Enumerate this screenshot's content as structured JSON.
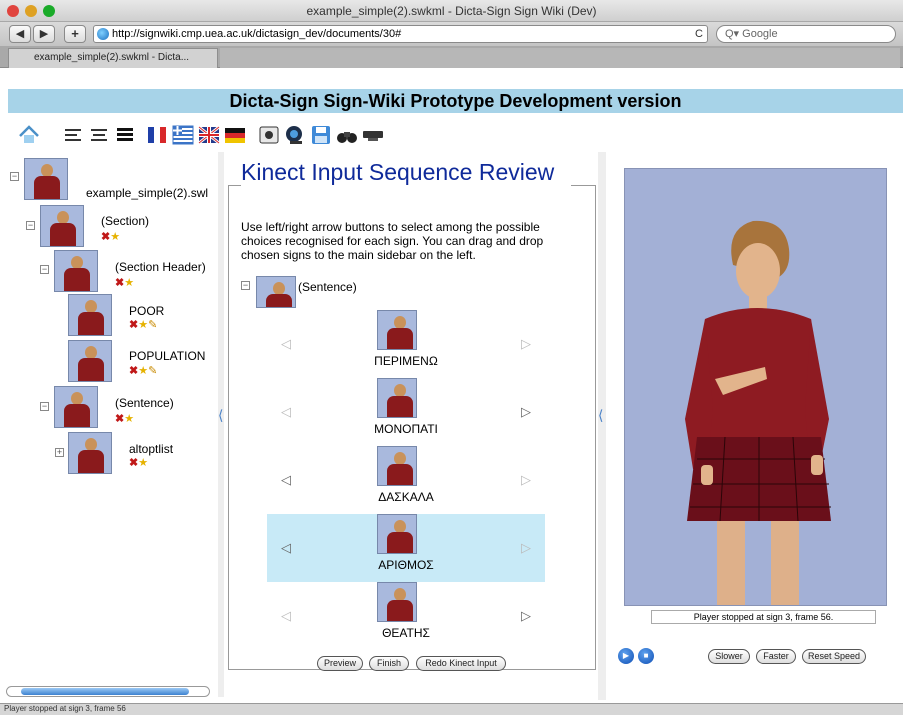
{
  "window": {
    "title": "example_simple(2).swkml - Dicta-Sign Sign Wiki (Dev)"
  },
  "nav": {
    "url": "http://signwiki.cmp.uea.ac.uk/dictasign_dev/documents/30#",
    "search_placeholder": "Google",
    "reload": "C"
  },
  "tab": {
    "label": "example_simple(2).swkml - Dicta..."
  },
  "banner": {
    "title": "Dicta-Sign Sign-Wiki Prototype Development version"
  },
  "toolbar": {
    "icons": [
      "home-icon",
      "align-left-icon",
      "align-center-icon",
      "align-justify-icon",
      "flag-fr-icon",
      "flag-gr-icon",
      "flag-uk-icon",
      "flag-de-icon",
      "kinect-icon",
      "webcam-icon",
      "save-icon",
      "binoculars-icon",
      "keyboard-icon"
    ]
  },
  "tree": {
    "root": "example_simple(2).swl",
    "section": "(Section)",
    "section_header": "(Section Header)",
    "poor": "POOR",
    "population": "POPULATION",
    "sentence": "(Sentence)",
    "altoptlist": "altoptlist",
    "collapse_symbol": "−",
    "expand_symbol": "+"
  },
  "review": {
    "title": "Kinect Input Sequence Review",
    "instructions": "Use left/right arrow buttons to select among the possible choices recognised for each sign. You can drag and drop chosen signs to the main sidebar on the left.",
    "sentence": "(Sentence)",
    "signs": [
      "ΠΕΡΙΜΕΝΩ",
      "ΜΟΝΟΠΑΤΙ",
      "ΔΑΣΚΑΛΑ",
      "ΑΡΙΘΜΟΣ",
      "ΘΕΑΤΗΣ"
    ],
    "selected_index": 3
  },
  "buttons": {
    "preview": "Preview",
    "finish": "Finish",
    "redo": "Redo Kinect Input"
  },
  "player": {
    "status": "Player stopped at sign 3, frame 56.",
    "slower": "Slower",
    "faster": "Faster",
    "reset": "Reset Speed"
  },
  "statusbar": {
    "text": "Player stopped at sign 3, frame 56"
  },
  "colors": {
    "banner": "#a7d3e8",
    "title_blue": "#0f2a9a",
    "selected_row": "#c8eaf7",
    "avatar_bg": "#a3b0d6"
  }
}
